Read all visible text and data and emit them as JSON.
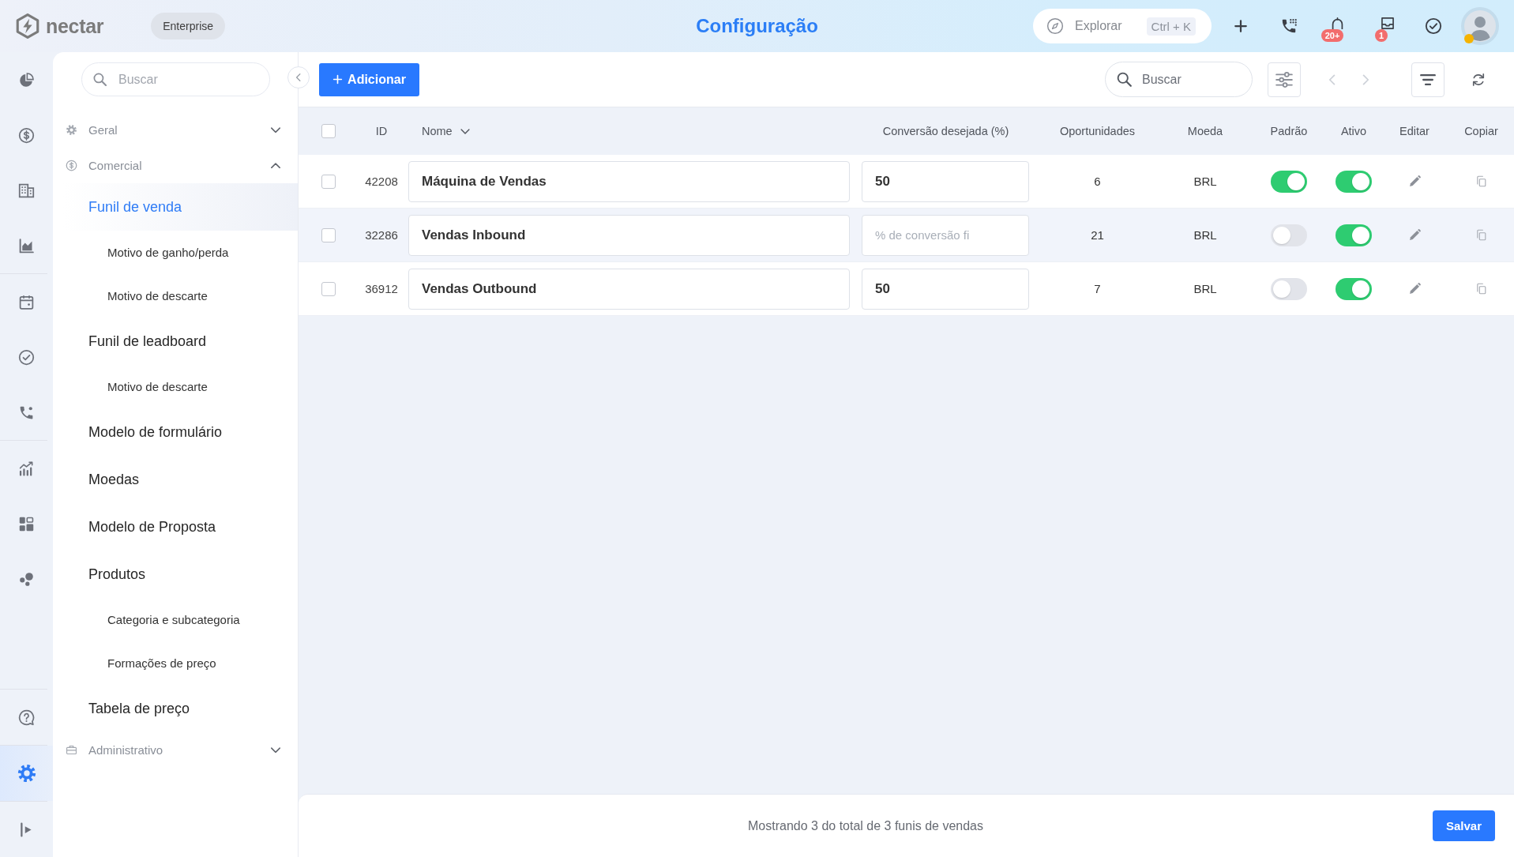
{
  "top_bar": {
    "logo": "nectar",
    "plan": "Enterprise",
    "title": "Configuração",
    "explore": {
      "placeholder": "Explorar",
      "shortcut": "Ctrl + K"
    },
    "notifications_badge": "20+",
    "inbox_badge": "1"
  },
  "rail": {
    "top_groups": [
      [
        {
          "selected": false
        },
        {
          "selected": false
        },
        {
          "selected": false
        },
        {
          "selected": false
        }
      ],
      [
        {
          "selected": false
        },
        {
          "selected": false
        },
        {
          "selected": false
        }
      ],
      [
        {
          "selected": false
        },
        {
          "selected": false
        },
        {
          "selected": false
        }
      ]
    ],
    "bottom_groups": [
      [
        {
          "selected": false
        }
      ],
      [
        {
          "selected": true
        }
      ],
      [
        {
          "selected": false
        }
      ]
    ]
  },
  "nav": {
    "search": {
      "placeholder": "Buscar"
    },
    "sections": [
      {
        "label": "Geral",
        "expanded": false
      },
      {
        "label": "Comercial",
        "expanded": true,
        "items": [
          {
            "label": "Funil de venda",
            "selected": true,
            "children": [
              {
                "label": "Motivo de ganho/perda",
                "selected": false
              },
              {
                "label": "Motivo de descarte",
                "selected": false
              }
            ]
          },
          {
            "label": "Funil de leadboard",
            "selected": false,
            "children": [
              {
                "label": "Motivo de descarte",
                "selected": false
              }
            ]
          },
          {
            "label": "Modelo de formulário",
            "selected": false
          },
          {
            "label": "Moedas",
            "selected": false
          },
          {
            "label": "Modelo de Proposta",
            "selected": false
          },
          {
            "label": "Produtos",
            "selected": false,
            "children": [
              {
                "label": "Categoria e subcategoria",
                "selected": false
              },
              {
                "label": "Formações de preço",
                "selected": false
              }
            ]
          },
          {
            "label": "Tabela de preço",
            "selected": false
          }
        ]
      },
      {
        "label": "Administrativo",
        "expanded": false
      }
    ]
  },
  "toolbar": {
    "add_button": "Adicionar",
    "search": {
      "placeholder": "Buscar"
    },
    "prev_disabled": true,
    "next_disabled": true
  },
  "table": {
    "all_checked": false,
    "columns": [
      {
        "label": "ID",
        "sortable": false
      },
      {
        "label": "Nome",
        "sortable": true
      },
      {
        "label": "Conversão desejada (%)",
        "sortable": false
      },
      {
        "label": "Oportunidades",
        "sortable": false
      },
      {
        "label": "Moeda",
        "sortable": false
      },
      {
        "label": "Padrão",
        "sortable": false
      },
      {
        "label": "Ativo",
        "sortable": false
      },
      {
        "label": "Editar",
        "sortable": false
      },
      {
        "label": "Copiar",
        "sortable": false
      }
    ],
    "rows": [
      {
        "checked": false,
        "hovered": false,
        "id": "42208",
        "name": "Máquina de Vendas",
        "conversion": "50",
        "opportunities": "6",
        "currency": "BRL",
        "default": true,
        "active": true
      },
      {
        "checked": false,
        "hovered": true,
        "id": "32286",
        "name": "Vendas Inbound",
        "conversion_placeholder": "% de conversão fi",
        "opportunities": "21",
        "currency": "BRL",
        "default": false,
        "active": true
      },
      {
        "checked": false,
        "hovered": false,
        "id": "36912",
        "name": "Vendas Outbound",
        "conversion": "50",
        "opportunities": "7",
        "currency": "BRL",
        "default": false,
        "active": true
      }
    ]
  },
  "footer": {
    "summary": "Mostrando 3 do total de 3 funis de vendas",
    "save_button": "Salvar"
  }
}
